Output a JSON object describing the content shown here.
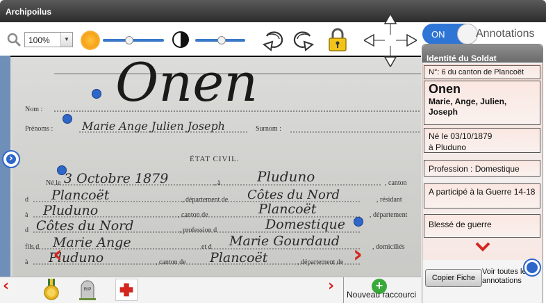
{
  "app": {
    "title": "Archipoilus"
  },
  "toolbar": {
    "zoom_value": "100%",
    "icons": [
      "magnifier-icon",
      "brightness-sun-icon",
      "contrast-icon",
      "rotate-left-icon",
      "rotate-right-icon",
      "lock-icon",
      "pan-arrows-icon"
    ],
    "brightness_level": 0.55,
    "contrast_level": 0.6
  },
  "document": {
    "big_name": "Onen",
    "labels": {
      "nom": "Nom :",
      "prenoms": "Prénoms :",
      "surnom": "Surnom :",
      "etat_civil": "ÉTAT CIVIL.",
      "ne_le": "Né le",
      "a1": ", à",
      "canton": ", canton",
      "de1": "d",
      "departement_des": ", département de",
      "resident": ", résidant",
      "a2": "à",
      "canton_de": ", canton de",
      "departement": ", département",
      "des": "d",
      "profession": ", profession d",
      "fils_de": "fils d",
      "et_de": "et d",
      "domicilies": ", domiciliés",
      "a3": "à",
      "canton_de2": ", canton de",
      "departement_de2": ", département de"
    },
    "handwritten": {
      "prenoms": "Marie Ange Julien Joseph",
      "date": "3 Octobre 1879",
      "lieu": "Pluduno",
      "canton": "Plancoët",
      "departement": "Côtes du Nord",
      "residence": "Pluduno",
      "canton_res": "Plancoët",
      "dept_res": "Côtes du Nord",
      "profession": "Domestique",
      "pere": "Marie Ange",
      "mere": "Marie Gourdaud",
      "domicile": "Pluduno",
      "canton_dom": "Plancoët"
    }
  },
  "bottom": {
    "shortcuts": [
      "medal-icon",
      "tombstone-icon",
      "red-cross-icon"
    ],
    "tombstone_text": "RIP",
    "new_shortcut": "Nouveau raccourci"
  },
  "annotations": {
    "toggle": "ON",
    "label": "Annotations",
    "panel_title": "Identité du Soldat",
    "canton_number": "N°: 6 du canton de Plancoët",
    "surname": "Onen",
    "first_names": "Marie, Ange, Julien, Joseph",
    "birth": "Né le 03/10/1879",
    "birth_place": "à Pluduno",
    "profession": "Profession : Domestique",
    "war": "A participé à la Guerre 14-18",
    "injury": "Blessé de guerre",
    "copy_button": "Copier Fiche",
    "see_all": "Voir toutes les annotations"
  }
}
